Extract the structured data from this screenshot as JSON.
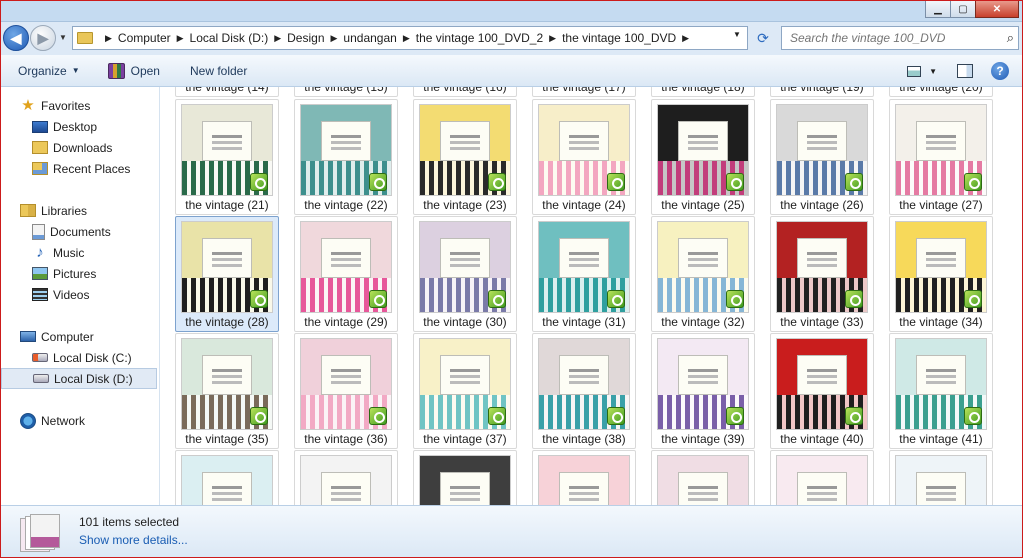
{
  "window": {
    "minimize_glyph": "▁",
    "maximize_glyph": "▢",
    "close_glyph": "✕"
  },
  "nav": {
    "back_glyph": "◀",
    "forward_glyph": "▶",
    "history_glyph": "▼"
  },
  "address": {
    "crumbs": [
      "Computer",
      "Local Disk (D:)",
      "Design",
      "undangan",
      "the vintage 100_DVD_2",
      "the vintage 100_DVD"
    ],
    "separator": "▶",
    "dropdown_glyph": "▼",
    "refresh_glyph": "⟳"
  },
  "search": {
    "placeholder": "Search the vintage 100_DVD",
    "icon_glyph": "⌕"
  },
  "toolbar": {
    "organize_label": "Organize",
    "organize_caret": "▼",
    "open_label": "Open",
    "new_folder_label": "New folder",
    "view_caret": "▼",
    "help_glyph": "?"
  },
  "sidebar": {
    "favorites": {
      "label": "Favorites",
      "items": [
        "Desktop",
        "Downloads",
        "Recent Places"
      ]
    },
    "libraries": {
      "label": "Libraries",
      "items": [
        "Documents",
        "Music",
        "Pictures",
        "Videos"
      ]
    },
    "computer": {
      "label": "Computer",
      "items": [
        "Local Disk (C:)",
        "Local Disk (D:)"
      ],
      "selected": "Local Disk (D:)"
    },
    "network": {
      "label": "Network"
    }
  },
  "files": {
    "rows": [
      [
        "the vintage (14)",
        "the vintage (15)",
        "the vintage (16)",
        "the vintage (17)",
        "the vintage (18)",
        "the vintage (19)",
        "the vintage (20)"
      ],
      [
        "the vintage (21)",
        "the vintage (22)",
        "the vintage (23)",
        "the vintage (24)",
        "the vintage (25)",
        "the vintage (26)",
        "the vintage (27)"
      ],
      [
        "the vintage (28)",
        "the vintage (29)",
        "the vintage (30)",
        "the vintage (31)",
        "the vintage (32)",
        "the vintage (33)",
        "the vintage (34)"
      ],
      [
        "the vintage (35)",
        "the vintage (36)",
        "the vintage (37)",
        "the vintage (38)",
        "the vintage (39)",
        "the vintage (40)",
        "the vintage (41)"
      ],
      [
        "",
        "",
        "",
        "",
        "",
        "",
        ""
      ]
    ],
    "highlighted": "the vintage (28)",
    "thumb_colors": [
      [
        "#e8e8d8",
        "#7fb8b5",
        "#f3dc72",
        "#f7eec9",
        "#1e1e1e",
        "#d9d9d9",
        "#f3f0ea"
      ],
      [
        "#e9e3a8",
        "#f0d8dc",
        "#dcd0e0",
        "#6fbfc0",
        "#f7f1c0",
        "#b32222",
        "#f7d95a"
      ],
      [
        "#d9e8dc",
        "#f0d0da",
        "#f8f1c8",
        "#e0d8d8",
        "#f3e9f3",
        "#c91d1d",
        "#cfe9e6"
      ],
      [
        "#dbeff2",
        "#f3f3f3",
        "#3e3e3e",
        "#f7d2d8",
        "#f0dde4",
        "#f8eaf0",
        "#eef4f8"
      ]
    ],
    "stripe_colors": [
      [
        "#2a6a4a",
        "#3d8f8d",
        "#2a2a2a",
        "#f3a6c0",
        "#c23d7b",
        "#5a7aa8",
        "#e57aa3"
      ],
      [
        "#1e1e1e",
        "#e7579a",
        "#7a7aa8",
        "#2f9f9f",
        "#86b6d6",
        "#202020",
        "#202020"
      ],
      [
        "#7a6b5a",
        "#f2a9c4",
        "#70c4c4",
        "#3aa0a8",
        "#7a5fa8",
        "#1e1e1e",
        "#3a9f8f"
      ],
      [
        "#a8d8d8",
        "#e06a9a",
        "#6a3a6a",
        "#e9b5c5",
        "#f4c9d6",
        "#e6c0d0",
        "#7aaed6"
      ]
    ]
  },
  "details": {
    "count": "101 items selected",
    "more_link": "Show more details..."
  }
}
